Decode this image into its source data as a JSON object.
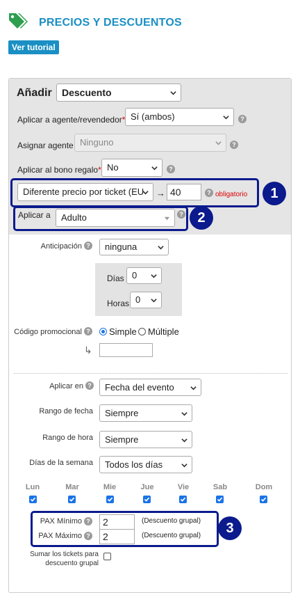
{
  "header": {
    "title": "PRECIOS Y DESCUENTOS",
    "tutorial_label": "Ver tutorial"
  },
  "add": {
    "label": "Añadir",
    "type_value": "Descuento"
  },
  "agent": {
    "label": "Aplicar a agente/revendedor",
    "required": "*",
    "value": "Sí (ambos)"
  },
  "assign_agent": {
    "label": "Asignar agente",
    "value": "Ninguno"
  },
  "gift": {
    "label": "Aplicar al bono regalo",
    "required": "*",
    "value": "No"
  },
  "price_rule": {
    "type_value": "Diferente precio por ticket (EU",
    "arrow": "→",
    "amount": "40",
    "required_text": "obligatorio"
  },
  "apply_to": {
    "label": "Aplicar a",
    "value": "Adulto"
  },
  "advance": {
    "label": "Anticipación",
    "value": "ninguna",
    "days_label": "Días",
    "days_value": "0",
    "hours_label": "Horas",
    "hours_value": "0"
  },
  "promo": {
    "label": "Código promocional",
    "simple": "Simple",
    "multiple": "Múltiple",
    "arrow": "↳",
    "code_value": ""
  },
  "apply_on": {
    "label": "Aplicar en",
    "value": "Fecha del evento"
  },
  "date_range": {
    "label": "Rango de fecha",
    "value": "Siempre"
  },
  "time_range": {
    "label": "Rango de hora",
    "value": "Siempre"
  },
  "weekdays": {
    "label": "Días de la semana",
    "value": "Todos los días",
    "days": [
      "Lun",
      "Mar",
      "Mie",
      "Jue",
      "Vie",
      "Sab",
      "Dom"
    ]
  },
  "pax": {
    "min_label": "PAX Mínimo",
    "min_value": "2",
    "min_note": "(Descuento grupal)",
    "max_label": "PAX Máximo",
    "max_value": "2",
    "max_note": "(Descuento grupal)"
  },
  "sum_tickets": {
    "label": "Sumar los tickets para descuento grupal"
  },
  "callouts": [
    "1",
    "2",
    "3"
  ],
  "colors": {
    "accent": "#1a8fc4",
    "callout": "#0b1a8c",
    "required": "#dd0000",
    "tag_icon": "#2e9e4f"
  }
}
